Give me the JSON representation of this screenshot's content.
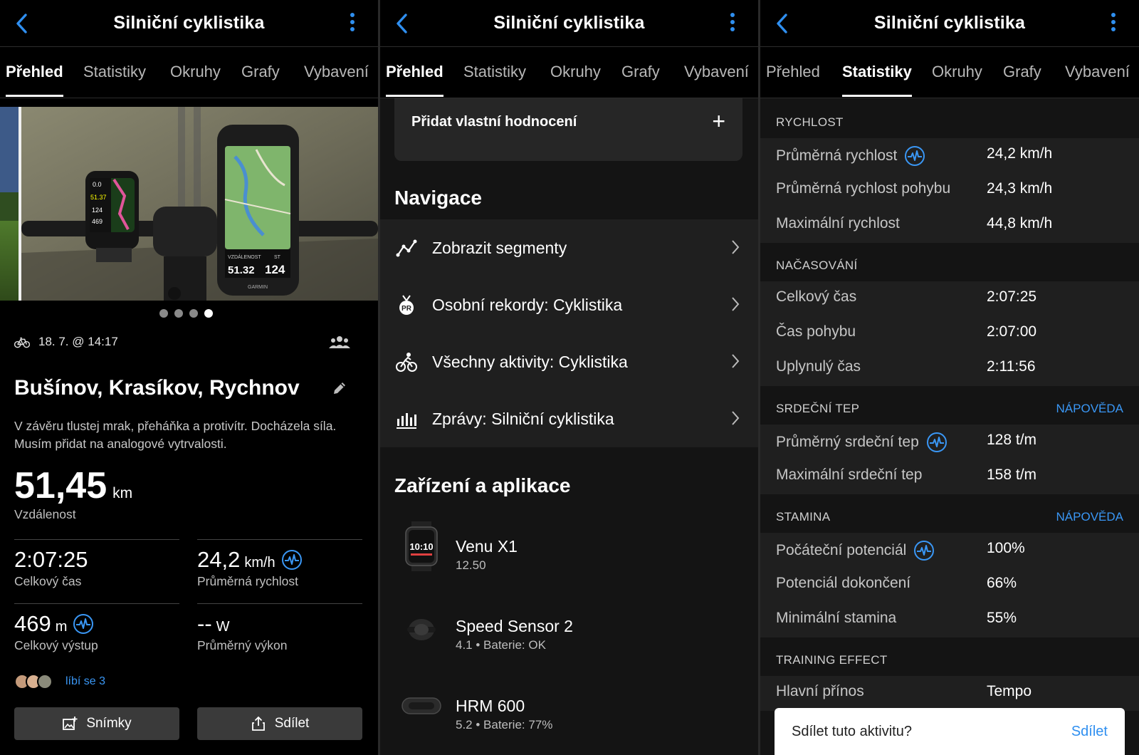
{
  "accent": "#2f8ff0",
  "panels": [
    {
      "header": {
        "title": "Silniční cyklistika",
        "back_icon": "chevron-left-icon",
        "menu_icon": "kebab-menu-icon"
      },
      "tabs": [
        "Přehled",
        "Statistiky",
        "Okruhy",
        "Grafy",
        "Vybavení"
      ],
      "active_tab": 0
    },
    {
      "header": {
        "title": "Silniční cyklistika"
      },
      "tabs": [
        "Přehled",
        "Statistiky",
        "Okruhy",
        "Grafy",
        "Vybavení"
      ],
      "active_tab": 0
    },
    {
      "header": {
        "title": "Silniční cyklistika"
      },
      "tabs": [
        "Přehled",
        "Statistiky",
        "Okruhy",
        "Grafy",
        "Vybavení"
      ],
      "active_tab": 1
    }
  ],
  "overview": {
    "carousel": {
      "count": 4,
      "active": 3
    },
    "photo_texts": {
      "left_device": [
        "0.0",
        "51.37",
        "124",
        "469"
      ],
      "right_device": [
        "VZDÁLENOST",
        "ST",
        "51.32",
        "124",
        "GARMIN"
      ]
    },
    "date": "18. 7. @ 14:17",
    "title": "Bušínov, Krasíkov, Rychnov",
    "description": "V závěru tlustej mrak, přeháňka a protivítr.   Docházela síla. Musím přidat na analogové vytrvalosti.",
    "distance": {
      "value": "51,45",
      "unit": "km",
      "label": "Vzdálenost"
    },
    "stats": [
      {
        "value": "2:07:25",
        "unit": "",
        "label": "Celkový čas",
        "pulse": false
      },
      {
        "value": "24,2",
        "unit": "km/h",
        "label": "Průměrná rychlost",
        "pulse": true
      },
      {
        "value": "469",
        "unit": "m",
        "label": "Celkový výstup",
        "pulse": true
      },
      {
        "value": "--",
        "unit": "W",
        "label": "Průměrný výkon",
        "pulse": false
      }
    ],
    "likes": "líbí se 3",
    "buttons": {
      "photos": "Snímky",
      "share": "Sdílet"
    }
  },
  "details": {
    "add_rating": "Přidat vlastní hodnocení",
    "navigation_title": "Navigace",
    "nav_items": [
      {
        "label": "Zobrazit segmenty",
        "icon": "segments-icon"
      },
      {
        "label": "Osobní rekordy: Cyklistika",
        "icon": "pr-medal-icon"
      },
      {
        "label": "Všechny aktivity: Cyklistika",
        "icon": "cyclist-icon"
      },
      {
        "label": "Zprávy: Silniční cyklistika",
        "icon": "bar-chart-icon"
      }
    ],
    "devices_title": "Zařízení a aplikace",
    "devices": [
      {
        "name": "Venu X1",
        "sub": "12.50",
        "icon": "watch-icon",
        "screen": "10:10"
      },
      {
        "name": "Speed Sensor 2",
        "sub": "4.1 • Baterie: OK",
        "icon": "speed-sensor-icon"
      },
      {
        "name": "HRM 600",
        "sub": "5.2 • Baterie: 77%",
        "icon": "hrm-strap-icon"
      }
    ]
  },
  "statistics": {
    "help_label": "NÁPOVĚDA",
    "sections": [
      {
        "title": "RYCHLOST",
        "help": false,
        "rows": [
          {
            "label": "Průměrná rychlost",
            "value": "24,2 km/h",
            "pulse": true
          },
          {
            "label": "Průměrná rychlost pohybu",
            "value": "24,3 km/h",
            "pulse": false
          },
          {
            "label": "Maximální rychlost",
            "value": "44,8 km/h",
            "pulse": false
          }
        ]
      },
      {
        "title": "NAČASOVÁNÍ",
        "help": false,
        "rows": [
          {
            "label": "Celkový čas",
            "value": "2:07:25",
            "pulse": false
          },
          {
            "label": "Čas pohybu",
            "value": "2:07:00",
            "pulse": false
          },
          {
            "label": "Uplynulý čas",
            "value": "2:11:56",
            "pulse": false
          }
        ]
      },
      {
        "title": "SRDEČNÍ TEP",
        "help": true,
        "rows": [
          {
            "label": "Průměrný srdeční tep",
            "value": "128 t/m",
            "pulse": true
          },
          {
            "label": "Maximální srdeční tep",
            "value": "158 t/m",
            "pulse": false
          }
        ]
      },
      {
        "title": "STAMINA",
        "help": true,
        "rows": [
          {
            "label": "Počáteční potenciál",
            "value": "100%",
            "pulse": true
          },
          {
            "label": "Potenciál dokončení",
            "value": "66%",
            "pulse": false
          },
          {
            "label": "Minimální stamina",
            "value": "55%",
            "pulse": false
          }
        ]
      },
      {
        "title": "TRAINING EFFECT",
        "help": false,
        "rows": [
          {
            "label": "Hlavní přínos",
            "value": "Tempo",
            "pulse": false
          }
        ]
      }
    ],
    "toast": {
      "text": "Sdílet tuto aktivitu?",
      "action": "Sdílet"
    }
  }
}
